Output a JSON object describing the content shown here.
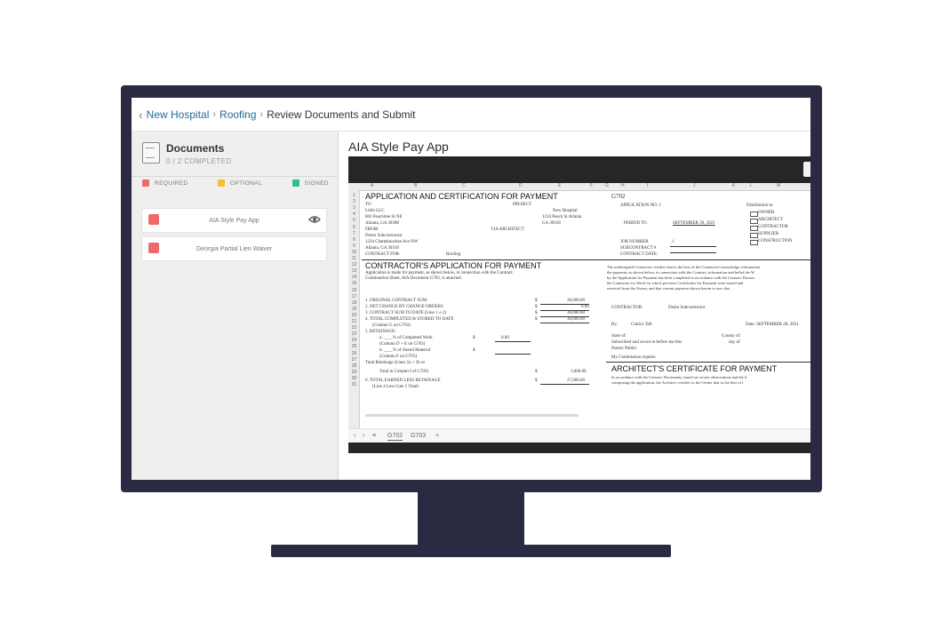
{
  "breadcrumb": {
    "back_icon": "chevron-left-icon",
    "items": [
      "New Hospital",
      "Roofing"
    ],
    "current": "Review Documents and Submit"
  },
  "sidebar": {
    "title": "Documents",
    "subtitle": "0 / 2 COMPLETED",
    "legend": [
      {
        "label": "REQUIRED",
        "color": "#ec6a6a"
      },
      {
        "label": "OPTIONAL",
        "color": "#f2c230"
      },
      {
        "label": "SIGNED",
        "color": "#2fbf8f"
      }
    ],
    "documents": [
      {
        "label": "AIA Style Pay App",
        "status_color": "#ec6a6a",
        "icon": "eye-icon"
      },
      {
        "label": "Georgia Partial Lien Waiver",
        "status_color": "#ec6a6a"
      }
    ]
  },
  "main": {
    "title": "AIA Style Pay App"
  },
  "sheet": {
    "columns": [
      "A",
      "B",
      "C",
      "D",
      "E",
      "F",
      "G",
      "H",
      "I",
      "J",
      "K",
      "L",
      "M"
    ],
    "rows": [
      "1",
      "2",
      "3",
      "4",
      "5",
      "6",
      "7",
      "8",
      "9",
      "10",
      "11",
      "12",
      "13",
      "14",
      "15",
      "16",
      "17",
      "18",
      "19",
      "20",
      "21",
      "22",
      "23",
      "24",
      "25",
      "26",
      "27",
      "28",
      "29",
      "30",
      "31"
    ],
    "heading": "APPLICATION AND CERTIFICATION FOR PAYMENT",
    "form_no": "G702",
    "to": "TO",
    "project": "PROJECT",
    "owner_name": "Little LLC",
    "owner_address1": "803 Peachtree St NE",
    "owner_address2": "Atlanta, GA 30308",
    "project_name": "New Hospital",
    "project_address1": "1234 Peach St Atlanta",
    "project_address2": "GA 30318",
    "application_no": "APPLICATION NO: 1",
    "distribution": "Distribution to:",
    "dist_items": [
      "OWNER",
      "ARCHITECT",
      "CONTRACTOR",
      "SUPPLIER",
      "CONSTRUCTION"
    ],
    "from": "FROM",
    "via_architect": "VIA ARCHITECT",
    "period_to": "PERIOD TO",
    "period_date": "SEPTEMBER 30, 2021",
    "from_name": "Demo Subcontractor",
    "from_address1": "1234 Chattahoochee Ave NW",
    "from_address2": "Atlanta, GA 30318",
    "job_number": "JOB NUMBER",
    "job_number_value": "1",
    "subcontract": "SUBCONTRACT #",
    "contract_date": "CONTRACT DATE:",
    "contract_for": "CONTRACT FOR:",
    "contract_for_value": "Roofing",
    "app_heading": "CONTRACTOR'S APPLICATION FOR PAYMENT",
    "app_note1": "Application is made for payment, as shown below, in connection with the Contract.",
    "app_note2": "Continuation Sheet, AIA Document G703, is attached.",
    "lines": [
      "1. ORIGINAL CONTRACT SUM",
      "2. NET CHANGE BY CHANGE ORDERS",
      "3. CONTRACT SUM TO DATE (Line 1 ± 2)",
      "4. TOTAL COMPLETED & STORED TO DATE",
      "(Column G on G703)",
      "5. RETAINAGE:",
      "a. ____% of Completed Work",
      "(Column D + E on G703)",
      "b. ____% of Stored Material",
      "(Column F on G703)",
      "Total Retainage (Lines 5a + 5b or",
      "Total in Column I of G703)",
      "6. TOTAL EARNED LESS RETAINAGE",
      "(Line 4 Less Line 5 Total)"
    ],
    "amounts": [
      "30,000.00",
      "0.00",
      "30,000.00",
      "30,000.00",
      "0.00",
      "3,000.00",
      "27,000.00"
    ],
    "cert_text1": "The undersigned Contractor certifies that to the best of the Contractor's knowledge, information",
    "cert_text2": "the payment, as shown below, in connection with the Contract, information and belief the W",
    "cert_text3": "by the Application for Payment has been completed in accordance with the Contract Docum",
    "cert_text4": "the Contractor for Work for which previous Certificates for Payment were issued and",
    "cert_text5": "received from the Owner, and that current payment shown herein is now due.",
    "contractor": "CONTRACTOR:",
    "contractor_value": "Demo Subcontractor",
    "by": "By:",
    "by_value": "Clarice Taft",
    "date": "Date: SEPTEMBER 28, 2021",
    "state_of": "State of:",
    "county_of": "County of:",
    "subscribed": "Subscribed and sworn to before me this",
    "day_of": "day of",
    "notary": "Notary Public:",
    "commission": "My Commission expires:",
    "arch_heading": "ARCHITECT'S CERTIFICATE FOR PAYMENT",
    "arch_text1": "In accordance with the Contract Documents, based on on-site observations and the d",
    "arch_text2": "comprising the application, the Architect certifies to the Owner that to the best of t",
    "tabs": [
      "G702",
      "G703"
    ]
  },
  "colors": {
    "bezel": "#2a2b42",
    "link": "#1f6b9a",
    "viewer_bar": "#262626"
  }
}
